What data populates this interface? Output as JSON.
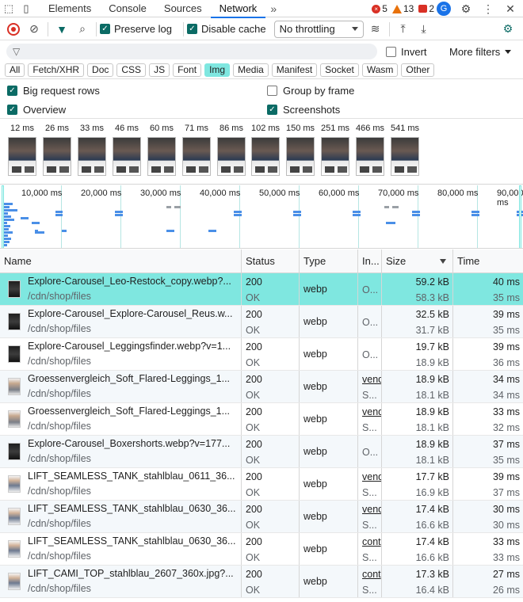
{
  "tabs": [
    {
      "label": "Elements"
    },
    {
      "label": "Console"
    },
    {
      "label": "Sources"
    },
    {
      "label": "Network"
    }
  ],
  "counts": {
    "errors": "5",
    "warnings": "13",
    "issues": "2"
  },
  "toolbar": {
    "preserve_log": "Preserve log",
    "disable_cache": "Disable cache",
    "throttling": "No throttling"
  },
  "filter": {
    "placeholder": "",
    "invert": "Invert",
    "more_filters": "More filters"
  },
  "types": [
    "All",
    "Fetch/XHR",
    "Doc",
    "CSS",
    "JS",
    "Font",
    "Img",
    "Media",
    "Manifest",
    "Socket",
    "Wasm",
    "Other"
  ],
  "active_type": "Img",
  "options": {
    "big_rows": "Big request rows",
    "overview": "Overview",
    "group_by_frame": "Group by frame",
    "screenshots": "Screenshots"
  },
  "screenshot_times": [
    "12 ms",
    "26 ms",
    "33 ms",
    "46 ms",
    "60 ms",
    "71 ms",
    "86 ms",
    "102 ms",
    "150 ms",
    "251 ms",
    "466 ms",
    "541 ms"
  ],
  "overview_labels": [
    "10,000 ms",
    "20,000 ms",
    "30,000 ms",
    "40,000 ms",
    "50,000 ms",
    "60,000 ms",
    "70,000 ms",
    "80,000 ms",
    "90,000 ms"
  ],
  "columns": {
    "name": "Name",
    "status": "Status",
    "type": "Type",
    "initiator": "In...",
    "size": "Size",
    "time": "Time"
  },
  "rows": [
    {
      "name": "Explore-Carousel_Leo-Restock_copy.webp?...",
      "path": "/cdn/shop/files",
      "status": "200",
      "status_text": "OK",
      "type": "webp",
      "init1": "O...",
      "init2": "",
      "size1": "59.2 kB",
      "size2": "58.3 kB",
      "time1": "40 ms",
      "time2": "35 ms",
      "selected": true,
      "thumb": "dark"
    },
    {
      "name": "Explore-Carousel_Explore-Carousel_Reus.w...",
      "path": "/cdn/shop/files",
      "status": "200",
      "status_text": "OK",
      "type": "webp",
      "init1": "O...",
      "init2": "",
      "size1": "32.5 kB",
      "size2": "31.7 kB",
      "time1": "39 ms",
      "time2": "35 ms",
      "selected": false,
      "thumb": "dark"
    },
    {
      "name": "Explore-Carousel_Leggingsfinder.webp?v=1...",
      "path": "/cdn/shop/files",
      "status": "200",
      "status_text": "OK",
      "type": "webp",
      "init1": "O...",
      "init2": "",
      "size1": "19.7 kB",
      "size2": "18.9 kB",
      "time1": "39 ms",
      "time2": "36 ms",
      "selected": false,
      "thumb": "dark"
    },
    {
      "name": "Groessenvergleich_Soft_Flared-Leggings_1...",
      "path": "/cdn/shop/files",
      "status": "200",
      "status_text": "OK",
      "type": "webp",
      "init1": "vend",
      "init2": "S...",
      "size1": "18.9 kB",
      "size2": "18.1 kB",
      "time1": "34 ms",
      "time2": "34 ms",
      "selected": false,
      "thumb": "pale"
    },
    {
      "name": "Groessenvergleich_Soft_Flared-Leggings_1...",
      "path": "/cdn/shop/files",
      "status": "200",
      "status_text": "OK",
      "type": "webp",
      "init1": "vend",
      "init2": "S...",
      "size1": "18.9 kB",
      "size2": "18.1 kB",
      "time1": "33 ms",
      "time2": "32 ms",
      "selected": false,
      "thumb": "pale"
    },
    {
      "name": "Explore-Carousel_Boxershorts.webp?v=177...",
      "path": "/cdn/shop/files",
      "status": "200",
      "status_text": "OK",
      "type": "webp",
      "init1": "O...",
      "init2": "",
      "size1": "18.9 kB",
      "size2": "18.1 kB",
      "time1": "37 ms",
      "time2": "35 ms",
      "selected": false,
      "thumb": "dark"
    },
    {
      "name": "LIFT_SEAMLESS_TANK_stahlblau_0611_36...",
      "path": "/cdn/shop/files",
      "status": "200",
      "status_text": "OK",
      "type": "webp",
      "init1": "vend",
      "init2": "S...",
      "size1": "17.7 kB",
      "size2": "16.9 kB",
      "time1": "39 ms",
      "time2": "37 ms",
      "selected": false,
      "thumb": "blue"
    },
    {
      "name": "LIFT_SEAMLESS_TANK_stahlblau_0630_36...",
      "path": "/cdn/shop/files",
      "status": "200",
      "status_text": "OK",
      "type": "webp",
      "init1": "vend",
      "init2": "S...",
      "size1": "17.4 kB",
      "size2": "16.6 kB",
      "time1": "30 ms",
      "time2": "30 ms",
      "selected": false,
      "thumb": "blue"
    },
    {
      "name": "LIFT_SEAMLESS_TANK_stahlblau_0630_36...",
      "path": "/cdn/shop/files",
      "status": "200",
      "status_text": "OK",
      "type": "webp",
      "init1": "cont",
      "init2": "S...",
      "size1": "17.4 kB",
      "size2": "16.6 kB",
      "time1": "33 ms",
      "time2": "33 ms",
      "selected": false,
      "thumb": "blue"
    },
    {
      "name": "LIFT_CAMI_TOP_stahlblau_2607_360x.jpg?...",
      "path": "/cdn/shop/files",
      "status": "200",
      "status_text": "OK",
      "type": "webp",
      "init1": "cont",
      "init2": "S...",
      "size1": "17.3 kB",
      "size2": "16.4 kB",
      "time1": "27 ms",
      "time2": "26 ms",
      "selected": false,
      "thumb": "blue"
    }
  ]
}
